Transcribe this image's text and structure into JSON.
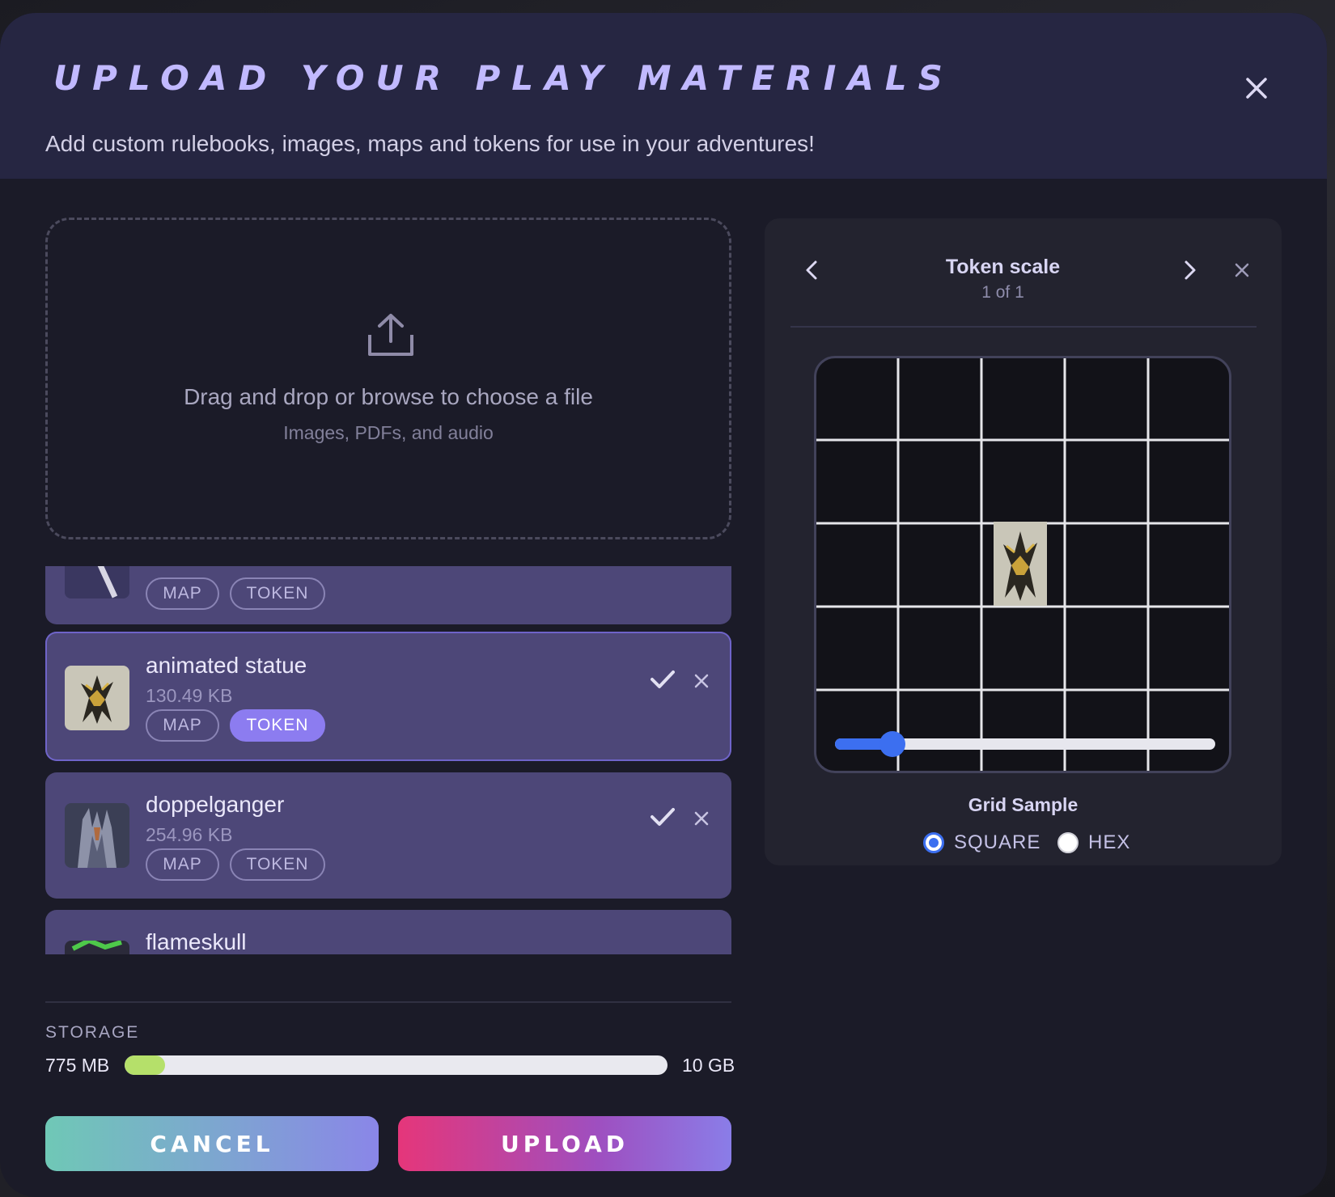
{
  "modal": {
    "title": "UPLOAD YOUR PLAY MATERIALS",
    "subtitle": "Add custom rulebooks, images, maps and tokens for use in your adventures!"
  },
  "dropzone": {
    "text": "Drag and drop or browse to choose a file",
    "subtext": "Images, PDFs, and audio"
  },
  "files": [
    {
      "name": "",
      "size": "",
      "tags": [
        "MAP",
        "TOKEN"
      ],
      "active_tag": ""
    },
    {
      "name": "animated statue",
      "size": "130.49 KB",
      "tags": [
        "MAP",
        "TOKEN"
      ],
      "active_tag": "TOKEN"
    },
    {
      "name": "doppelganger",
      "size": "254.96 KB",
      "tags": [
        "MAP",
        "TOKEN"
      ],
      "active_tag": ""
    },
    {
      "name": "flameskull",
      "size": "",
      "tags": [],
      "active_tag": ""
    }
  ],
  "storage": {
    "label": "STORAGE",
    "used": "775 MB",
    "total": "10 GB",
    "fraction_used": 0.075
  },
  "buttons": {
    "cancel": "CANCEL",
    "upload": "UPLOAD"
  },
  "token_scale": {
    "title": "Token scale",
    "page": "1 of 1",
    "slider_fraction": 0.15,
    "grid_sample_label": "Grid Sample",
    "options": [
      "SQUARE",
      "HEX"
    ],
    "selected_option": "SQUARE"
  },
  "colors": {
    "accent": "#8c7cf0",
    "slider": "#3c6ff0",
    "storage_fill": "#b5e06a"
  }
}
